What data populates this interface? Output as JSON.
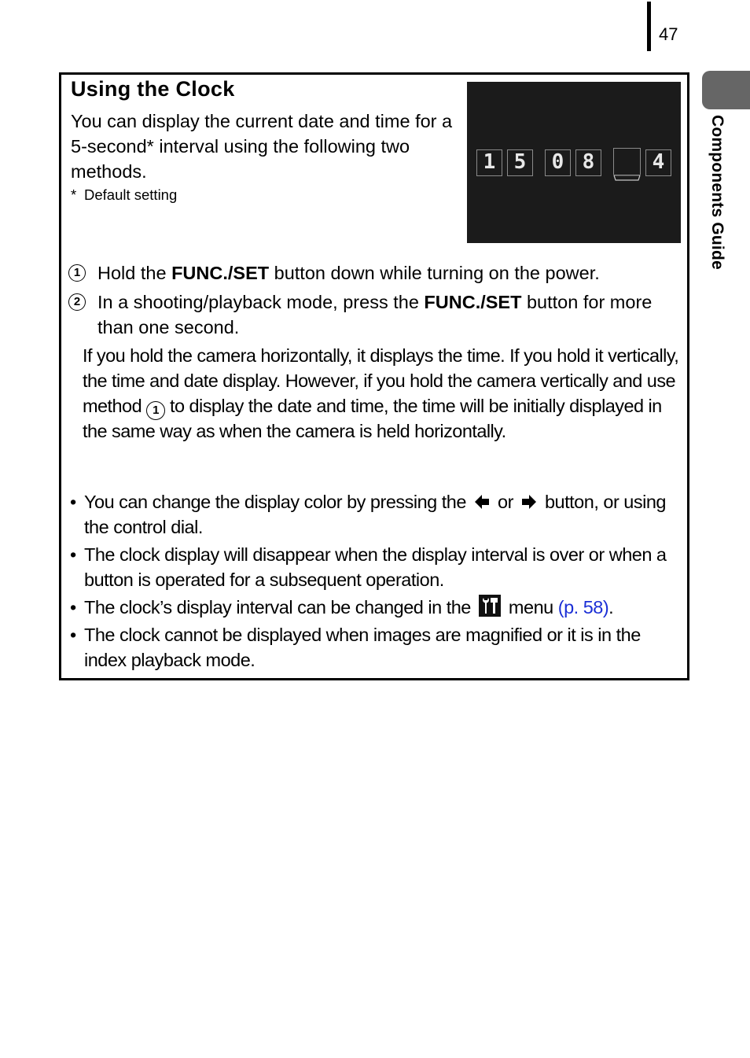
{
  "page": {
    "number": "47",
    "section_tab": "Components Guide"
  },
  "section": {
    "title": "Using the Clock",
    "intro": "You can display the current date and time for a 5-second* interval using the following two methods.",
    "footnote_mark": "*",
    "footnote": "Default setting",
    "clock_display": {
      "digits": [
        "1",
        "5",
        "0",
        "8",
        "",
        "4"
      ],
      "background": "#1b1b1b"
    },
    "steps": [
      {
        "number": "1",
        "text_before": "Hold the ",
        "bold": "FUNC./SET",
        "text_after": " button down while turning on the power."
      },
      {
        "number": "2",
        "text_before": "In a shooting/playback mode, press the ",
        "bold": "FUNC./SET",
        "text_after": " button for more than one second."
      }
    ],
    "note": {
      "text_before": "If you hold the camera horizontally, it displays the time. If you hold it vertically, the time and date display. However, if you hold the camera vertically and use method ",
      "ref_number": "1",
      "text_after": " to display the date and time, the time will be initially displayed in the same way as when the camera is held horizontally."
    },
    "bullets": [
      {
        "text_before": "You can change the display color by pressing the ",
        "icon_left": "left-arrow-icon",
        "connector": " or ",
        "icon_right": "right-arrow-icon",
        "text_after": " button, or using the control dial."
      },
      {
        "text": "The clock display will disappear when the display interval is over or when a button is operated for a subsequent operation."
      },
      {
        "text_before": "The clock’s display interval can be changed in the ",
        "icon": "setup-menu-tools-icon",
        "text_middle": " menu ",
        "link": "(p. 58)",
        "text_after": "."
      },
      {
        "text": "The clock cannot be displayed when images are magnified or it is in the index playback mode."
      }
    ],
    "bullet_char": "•"
  },
  "colors": {
    "link": "#1b2fd6",
    "side_tab": "#666666",
    "border": "#000000"
  }
}
